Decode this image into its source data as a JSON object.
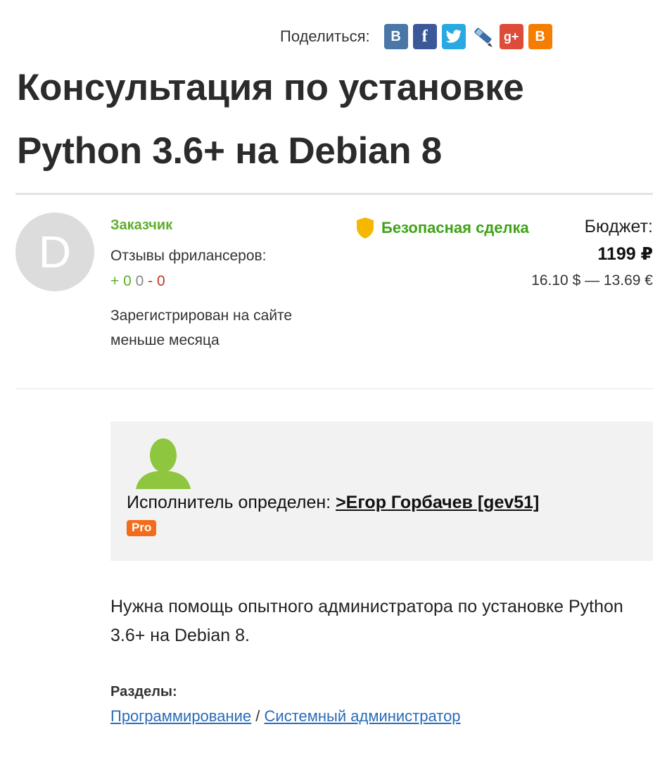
{
  "share": {
    "label": "Поделиться:",
    "buttons": [
      {
        "name": "vk",
        "glyph": "B",
        "color": "#4a76a8"
      },
      {
        "name": "facebook",
        "glyph": "f",
        "color": "#3b5998"
      },
      {
        "name": "twitter",
        "color": "#29a9e1"
      },
      {
        "name": "livejournal",
        "color": "#3b6ea5"
      },
      {
        "name": "google-plus",
        "glyph": "g+",
        "color": "#dd4b39"
      },
      {
        "name": "blogger",
        "glyph": "B",
        "color": "#f57d00"
      }
    ]
  },
  "project": {
    "title": "Консультация по установке Python 3.6+ на Debian 8",
    "description": "Нужна помощь опытного администратора по установке Python 3.6+ на Debian 8."
  },
  "customer": {
    "avatar_letter": "D",
    "role": "Заказчик",
    "reviews_label": "Отзывы фрилансеров:",
    "reviews": {
      "positive": "+ 0",
      "neutral": "0",
      "negative": "- 0"
    },
    "registered": "Зарегистрирован на сайте меньше месяца"
  },
  "deal": {
    "safe_label": "Безопасная сделка",
    "budget_label": "Бюджет:",
    "budget_amount": "1199 ₽",
    "budget_conversion": "16.10 $ — 13.69 €"
  },
  "executor": {
    "label": "Исполнитель определен:",
    "name_link": ">Егор Горбачев [gev51]",
    "badge": "Pro"
  },
  "sections": {
    "label": "Разделы:",
    "links": [
      "Программирование",
      "Системный администратор"
    ],
    "separator": "/"
  },
  "colors": {
    "green": "#5fae2c",
    "safe_green": "#3fa317",
    "link_blue": "#2a6cb8",
    "pro_orange": "#f26c1b"
  }
}
